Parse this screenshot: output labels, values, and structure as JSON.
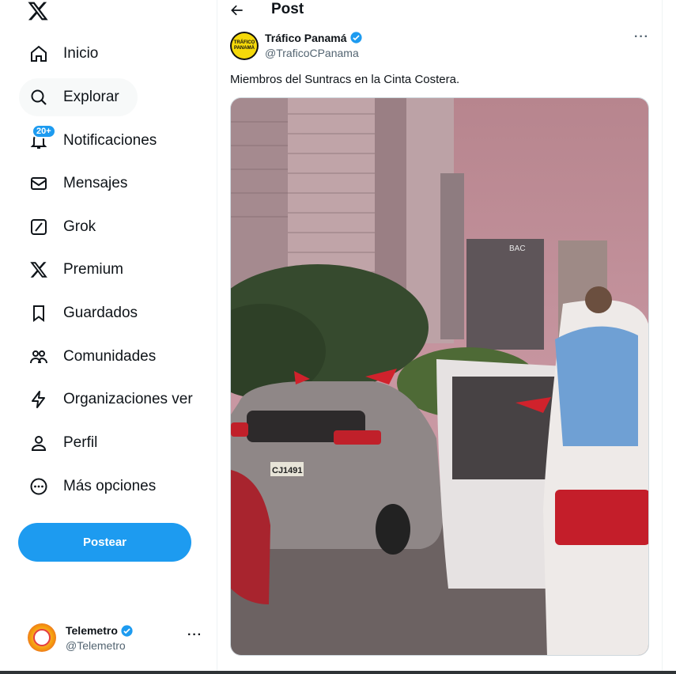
{
  "sidebar": {
    "logo_icon": "x-logo-icon",
    "nav": [
      {
        "label": "Inicio",
        "icon": "home-icon"
      },
      {
        "label": "Explorar",
        "icon": "search-icon"
      },
      {
        "label": "Notificaciones",
        "icon": "bell-icon",
        "badge": "20+"
      },
      {
        "label": "Mensajes",
        "icon": "envelope-icon"
      },
      {
        "label": "Grok",
        "icon": "grok-icon"
      },
      {
        "label": "Premium",
        "icon": "x-premium-icon"
      },
      {
        "label": "Guardados",
        "icon": "bookmark-icon"
      },
      {
        "label": "Comunidades",
        "icon": "people-icon"
      },
      {
        "label": "Organizaciones ver",
        "icon": "lightning-icon"
      },
      {
        "label": "Perfil",
        "icon": "person-icon"
      },
      {
        "label": "Más opciones",
        "icon": "more-circle-icon"
      }
    ],
    "post_button": "Postear",
    "account": {
      "name": "Telemetro",
      "handle": "@Telemetro",
      "more": "···"
    }
  },
  "main": {
    "header_title": "Post",
    "tweet": {
      "author_name": "Tráfico Panamá",
      "author_handle": "@TraficoCPanama",
      "avatar_text": "TRÁFICO PANAMÁ",
      "more": "···",
      "text": "Miembros del Suntracs en la Cinta Costera.",
      "media_signs": {
        "building_logo": "BAC",
        "plate": "CJ1491"
      }
    }
  },
  "colors": {
    "accent": "#1d9bf0",
    "text": "#0f1419",
    "muted": "#536471"
  }
}
